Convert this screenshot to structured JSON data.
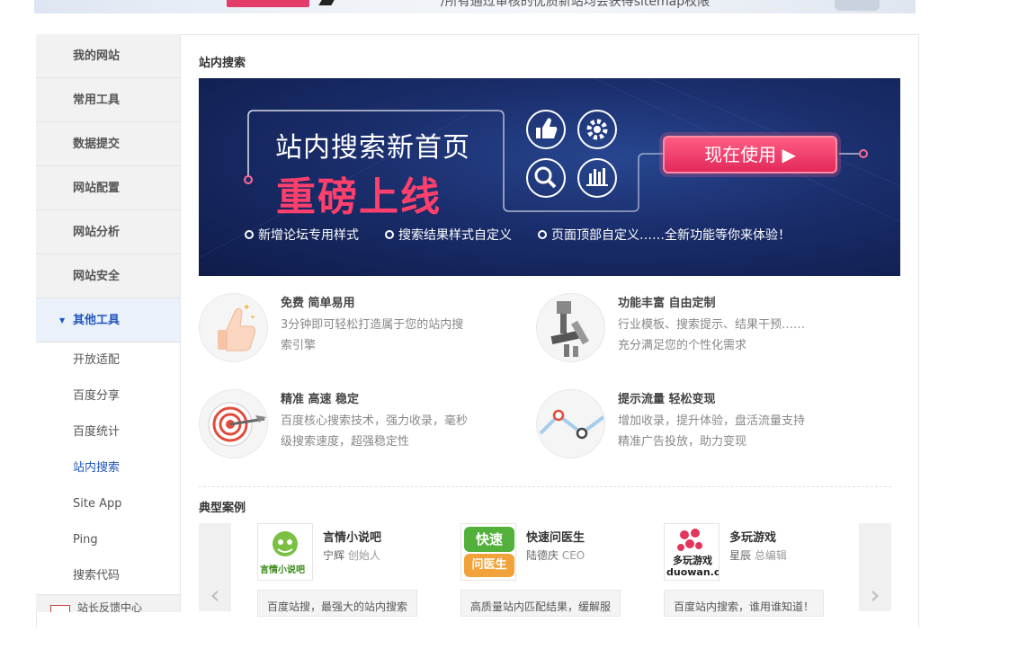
{
  "top_banner": {
    "text": "/所有通过审核的优质新站均会获得sitemap权限"
  },
  "sidebar": {
    "items": [
      {
        "label": "我的网站"
      },
      {
        "label": "常用工具"
      },
      {
        "label": "数据提交"
      },
      {
        "label": "网站配置"
      },
      {
        "label": "网站分析"
      },
      {
        "label": "网站安全"
      },
      {
        "label": "其他工具"
      }
    ],
    "sub_items": [
      {
        "label": "开放适配"
      },
      {
        "label": "百度分享"
      },
      {
        "label": "百度统计"
      },
      {
        "label": "站内搜索"
      },
      {
        "label": "Site App"
      },
      {
        "label": "Ping"
      },
      {
        "label": "搜索代码"
      }
    ],
    "bottom_label": "站长反馈中心"
  },
  "main": {
    "section_title": "站内搜索",
    "hero": {
      "title_line1": "站内搜索新首页",
      "title_line2": "重磅上线",
      "button_label": "现在使用 ▶",
      "features": [
        "新增论坛专用样式",
        "搜索结果样式自定义",
        "页面顶部自定义……全新功能等你来体验！"
      ]
    },
    "features": [
      {
        "title": "免费 简单易用",
        "desc": "3分钟即可轻松打造属于您的站内搜索引擎"
      },
      {
        "title": "功能丰富 自由定制",
        "desc": "行业模板、搜索提示、结果干预……充分满足您的个性化需求"
      },
      {
        "title": "精准 高速 稳定",
        "desc": "百度核心搜索技术，强力收录，毫秒级搜索速度，超强稳定性"
      },
      {
        "title": "提示流量 轻松变现",
        "desc": "增加收录，提升体验，盘活流量支持精准广告投放，助力变现"
      }
    ],
    "cases_title": "典型案例",
    "cases": [
      {
        "name": "言情小说吧",
        "person": "宁辉",
        "role": "创始人",
        "logo_text": "言情小说吧",
        "quote": "百度站搜，最强大的站内搜索"
      },
      {
        "name": "快速问医生",
        "person": "陆德庆",
        "role": "CEO",
        "logo_text": "快速问医生",
        "quote": "高质量站内匹配结果，缓解服"
      },
      {
        "name": "多玩游戏",
        "person": "星辰",
        "role": "总编辑",
        "logo_text": "多玩游戏 duowan.com",
        "quote": "百度站内搜索，谁用谁知道！"
      }
    ],
    "prev_arrow": "‹",
    "next_arrow": "›"
  },
  "colors": {
    "accent": "#2255bb",
    "hero_bg": "#1a2d6b",
    "hero_highlight": "#ff3f6c"
  }
}
